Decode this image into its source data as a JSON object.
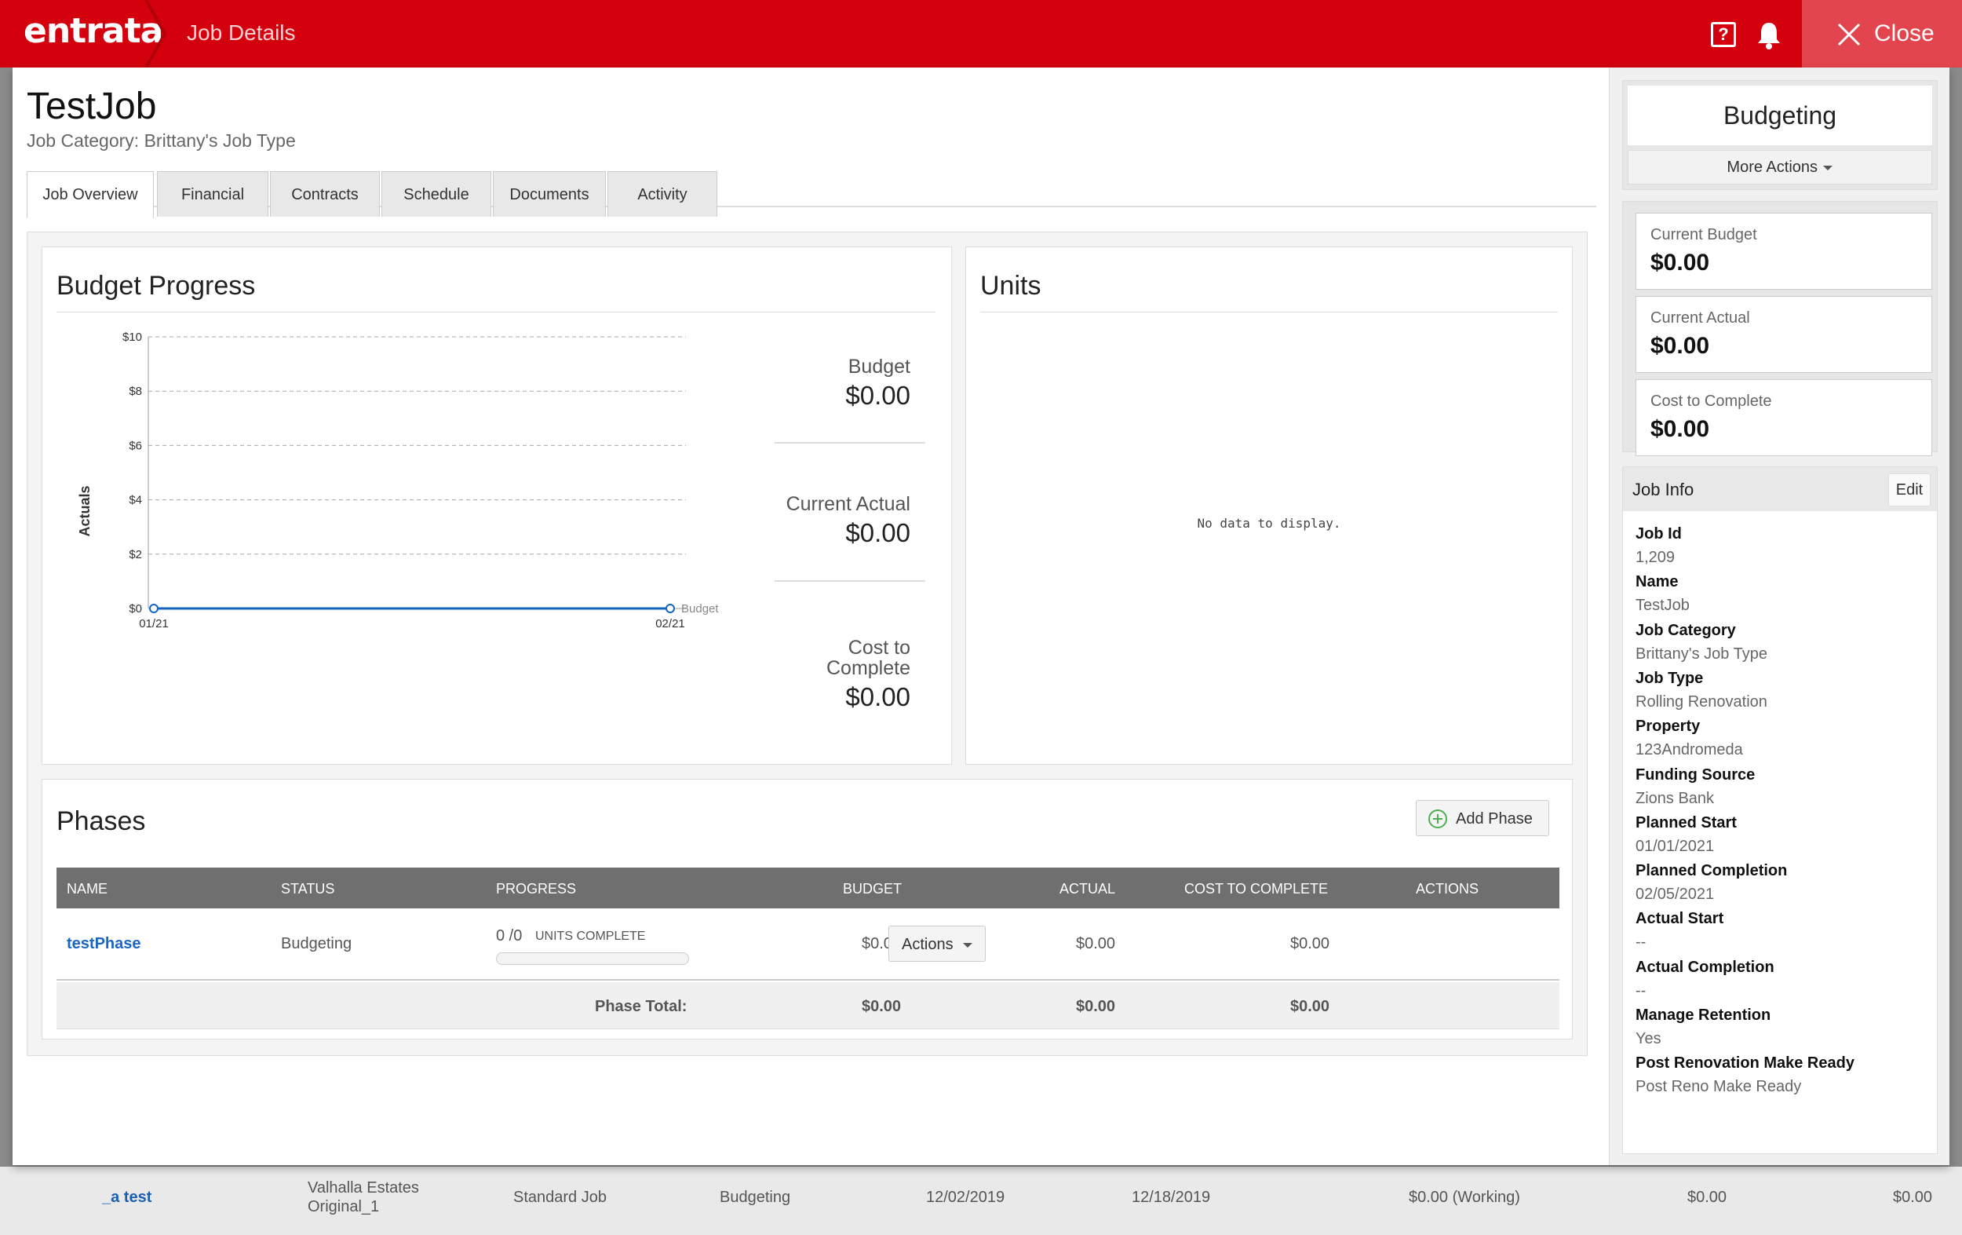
{
  "header": {
    "brand": "entrata",
    "page_title": "Job Details",
    "help_glyph": "?",
    "close_label": "Close",
    "color": "#d5000d"
  },
  "job": {
    "title": "TestJob",
    "category_line": "Job Category: Brittany's Job Type"
  },
  "tabs": [
    {
      "label": "Job Overview"
    },
    {
      "label": "Financial"
    },
    {
      "label": "Contracts"
    },
    {
      "label": "Schedule"
    },
    {
      "label": "Documents"
    },
    {
      "label": "Activity"
    }
  ],
  "budget_progress": {
    "title": "Budget Progress",
    "stats": [
      {
        "label": "Budget",
        "value": "$0.00"
      },
      {
        "label": "Current Actual",
        "value": "$0.00"
      },
      {
        "label_line1": "Cost to",
        "label_line2": "Complete",
        "value": "$0.00"
      }
    ]
  },
  "chart_data": {
    "type": "line",
    "title": "",
    "ylabel": "Actuals",
    "xlabel": "",
    "ylim": [
      0,
      10
    ],
    "y_ticks": [
      "$0",
      "$2",
      "$4",
      "$6",
      "$8",
      "$10"
    ],
    "x_ticks": [
      "01/21",
      "02/21"
    ],
    "grid": true,
    "series": [
      {
        "name": "Budget",
        "x": [
          "01/21",
          "02/21"
        ],
        "values": [
          0,
          0
        ],
        "color": "#1565c0"
      }
    ]
  },
  "units": {
    "title": "Units",
    "empty_text": "No data to display."
  },
  "phases": {
    "title": "Phases",
    "add_label": "Add Phase",
    "columns": [
      "NAME",
      "STATUS",
      "PROGRESS",
      "BUDGET",
      "ACTUAL",
      "COST TO COMPLETE",
      "ACTIONS"
    ],
    "rows": [
      {
        "name": "testPhase",
        "status": "Budgeting",
        "progress_count": "0 /0",
        "progress_unit": "UNITS COMPLETE",
        "progress_fraction": 0,
        "budget": "$0.00",
        "actual": "$0.00",
        "cost_to_complete": "$0.00",
        "actions_label": "Actions"
      }
    ],
    "total": {
      "label": "Phase Total:",
      "budget": "$0.00",
      "actual": "$0.00",
      "cost_to_complete": "$0.00"
    }
  },
  "side": {
    "status": "Budgeting",
    "more_actions": "More Actions",
    "summaries": [
      {
        "label": "Current Budget",
        "value": "$0.00"
      },
      {
        "label": "Current Actual",
        "value": "$0.00"
      },
      {
        "label": "Cost to Complete",
        "value": "$0.00"
      }
    ],
    "info_title": "Job Info",
    "edit_label": "Edit",
    "info": [
      {
        "key": "Job Id",
        "value": "1,209"
      },
      {
        "key": "Name",
        "value": "TestJob"
      },
      {
        "key": "Job Category",
        "value": "Brittany's Job Type"
      },
      {
        "key": "Job Type",
        "value": "Rolling Renovation"
      },
      {
        "key": "Property",
        "value": "123Andromeda"
      },
      {
        "key": "Funding Source",
        "value": "Zions Bank"
      },
      {
        "key": "Planned Start",
        "value": "01/01/2021"
      },
      {
        "key": "Planned Completion",
        "value": "02/05/2021"
      },
      {
        "key": "Actual Start",
        "value": "--"
      },
      {
        "key": "Actual Completion",
        "value": "--"
      },
      {
        "key": "Manage Retention",
        "value": "Yes"
      },
      {
        "key": "Post Renovation Make Ready",
        "value": "Post Reno Make Ready"
      }
    ]
  },
  "background_row": {
    "name": "_a test",
    "property_line1": "Valhalla Estates",
    "property_line2": "Original_1",
    "type": "Standard Job",
    "status": "Budgeting",
    "start": "12/02/2019",
    "end": "12/18/2019",
    "budget": "$0.00 (Working)",
    "actual": "$0.00",
    "cost": "$0.00"
  }
}
